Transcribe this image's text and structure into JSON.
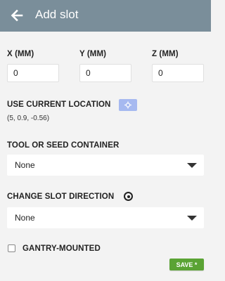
{
  "header": {
    "title": "Add slot",
    "back_icon": "arrow-left-icon"
  },
  "fields": {
    "x_label": "X (MM)",
    "y_label": "Y (MM)",
    "z_label": "Z (MM)",
    "x_value": "0",
    "y_value": "0",
    "z_value": "0"
  },
  "location": {
    "label": "USE CURRENT LOCATION",
    "button_icon": "crosshair-icon",
    "coords": "(5, 0.9, -0.56)"
  },
  "tool": {
    "label": "TOOL OR SEED CONTAINER",
    "selected": "None"
  },
  "direction": {
    "label": "CHANGE SLOT DIRECTION",
    "icon": "target-icon",
    "selected": "None"
  },
  "gantry": {
    "label": "GANTRY-MOUNTED",
    "checked": false
  },
  "save": {
    "label": "SAVE *"
  },
  "colors": {
    "header": "#7a8e9a",
    "save": "#5aa334",
    "location_button": "#a6b9f0"
  }
}
